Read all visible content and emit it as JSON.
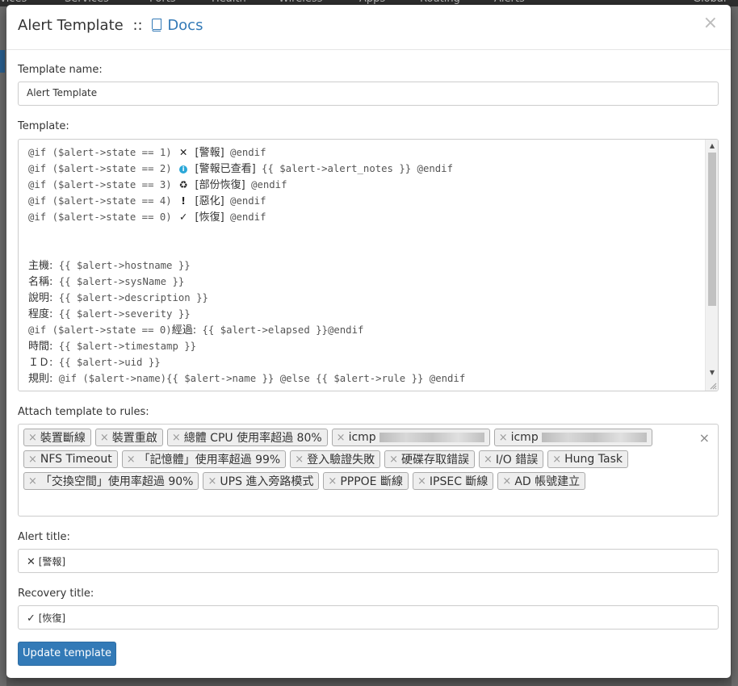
{
  "background_nav": {
    "items": [
      "evices",
      "Services",
      "Ports",
      "Health",
      "Wireless",
      "Apps",
      "Routing",
      "Alerts",
      "Global"
    ]
  },
  "modal": {
    "title": "Alert Template",
    "separator": "::",
    "docs_label": "Docs",
    "close_symbol": "×"
  },
  "template_name": {
    "label": "Template name:",
    "value": "Alert Template"
  },
  "template": {
    "label": "Template:",
    "lines": [
      {
        "pre": "@if ($alert->state == 1) ",
        "icon": "✕",
        "icon_name": "x-mark-icon",
        "text": "[警報]",
        "post": " @endif"
      },
      {
        "pre": "@if ($alert->state == 2) ",
        "icon": "i",
        "icon_name": "info-icon",
        "text": "[警報已查看]",
        "post": " {{ $alert->alert_notes }} @endif"
      },
      {
        "pre": "@if ($alert->state == 3) ",
        "icon": "♻",
        "icon_name": "recycle-icon",
        "text": "[部份恢復]",
        "post": " @endif"
      },
      {
        "pre": "@if ($alert->state == 4) ",
        "icon": "!",
        "icon_name": "exclamation-icon",
        "text": "[惡化]",
        "post": " @endif"
      },
      {
        "pre": "@if ($alert->state == 0) ",
        "icon": "✓",
        "icon_name": "check-icon",
        "text": "[恢復]",
        "post": " @endif"
      },
      {
        "pre": "",
        "icon": "",
        "icon_name": "",
        "text": "",
        "post": ""
      },
      {
        "pre": "",
        "icon": "",
        "icon_name": "",
        "text": "",
        "post": ""
      },
      {
        "pre": "",
        "icon": "",
        "icon_name": "",
        "text": "主機:",
        "post": " {{ $alert->hostname }}"
      },
      {
        "pre": "",
        "icon": "",
        "icon_name": "",
        "text": "名稱:",
        "post": " {{ $alert->sysName }}"
      },
      {
        "pre": "",
        "icon": "",
        "icon_name": "",
        "text": "說明:",
        "post": " {{ $alert->description }}"
      },
      {
        "pre": "",
        "icon": "",
        "icon_name": "",
        "text": "程度:",
        "post": " {{ $alert->severity }}"
      },
      {
        "pre": "@if ($alert->state == 0)",
        "icon": "",
        "icon_name": "",
        "text": "經過:",
        "post": " {{ $alert->elapsed }}@endif"
      },
      {
        "pre": "",
        "icon": "",
        "icon_name": "",
        "text": "時間:",
        "post": " {{ $alert->timestamp }}"
      },
      {
        "pre": "",
        "icon": "",
        "icon_name": "",
        "text": "ＩＤ:",
        "post": " {{ $alert->uid }}"
      },
      {
        "pre": "",
        "icon": "",
        "icon_name": "",
        "text": "規則:",
        "post": " @if ($alert->name){{ $alert->name }} @else {{ $alert->rule }} @endif"
      }
    ]
  },
  "rules": {
    "label": "Attach template to rules:",
    "tags": [
      {
        "text": "裝置斷線",
        "redacted": false
      },
      {
        "text": "裝置重啟",
        "redacted": false
      },
      {
        "text": "總體 CPU 使用率超過 80%",
        "redacted": false
      },
      {
        "text": "icmp",
        "redacted": true
      },
      {
        "text": "icmp",
        "redacted": true
      },
      {
        "text": "NFS Timeout",
        "redacted": false
      },
      {
        "text": "「記憶體」使用率超過 99%",
        "redacted": false
      },
      {
        "text": "登入驗證失敗",
        "redacted": false
      },
      {
        "text": "硬碟存取錯誤",
        "redacted": false
      },
      {
        "text": "I/O 錯誤",
        "redacted": false
      },
      {
        "text": "Hung Task",
        "redacted": false
      },
      {
        "text": "「交換空間」使用率超過 90%",
        "redacted": false
      },
      {
        "text": "UPS 進入旁路模式",
        "redacted": false
      },
      {
        "text": "PPPOE 斷線",
        "redacted": false
      },
      {
        "text": "IPSEC 斷線",
        "redacted": false
      },
      {
        "text": "AD 帳號建立",
        "redacted": false
      }
    ],
    "remove_symbol": "×",
    "clear_symbol": "×"
  },
  "alert_title": {
    "label": "Alert title:",
    "icon": "✕",
    "value": "[警報]"
  },
  "recovery_title": {
    "label": "Recovery title:",
    "icon": "✓",
    "value": "[恢復]"
  },
  "submit": {
    "label": "Update template"
  },
  "colors": {
    "primary": "#337ab7",
    "info": "#2aa7d8",
    "text": "#333333"
  }
}
